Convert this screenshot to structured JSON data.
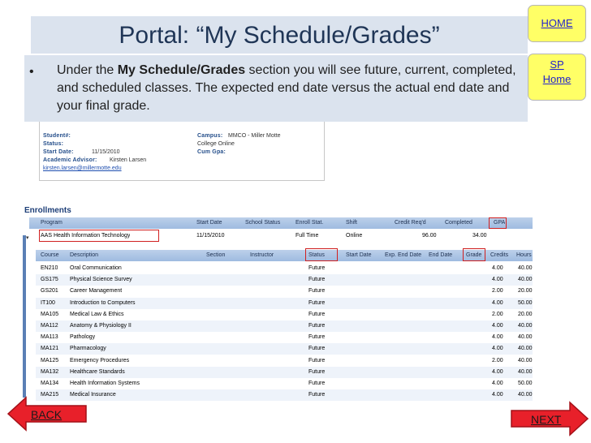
{
  "slide": {
    "title": "Portal: “My Schedule/Grades”",
    "bullet_pre": "Under the ",
    "bullet_bold": "My Schedule/Grades",
    "bullet_post": " section you will see future, current, completed, and scheduled classes. The expected end date versus the actual end date and your final grade."
  },
  "nav": {
    "home": "HOME",
    "sp_line1": "SP",
    "sp_line2": "Home",
    "back": "BACK",
    "next": "NEXT"
  },
  "student": {
    "student_label": "Student#:",
    "status_label": "Status:",
    "start_label": "Start Date:",
    "start_value": "11/15/2010",
    "advisor_label": "Academic Advisor:",
    "advisor_value": "Kirsten Larsen",
    "email": "kirsten.larsen@millermotte.edu",
    "campus_label": "Campus:",
    "campus_value": "MMCO - Miller Motte",
    "campus_status": "College Online",
    "gpa_label": "Cum Gpa:"
  },
  "enrollments": {
    "title": "Enrollments",
    "program_headers": [
      "Program",
      "Start Date",
      "School Status",
      "Enroll Stat.",
      "Shift",
      "Credit Req'd",
      "Completed",
      "GPA"
    ],
    "program_row": [
      "AAS Health Information Technology",
      "11/15/2010",
      "",
      "Full Time",
      "Online",
      "96.00",
      "34.00",
      ""
    ],
    "course_headers": [
      "Course",
      "Description",
      "Section",
      "Instructor",
      "Status",
      "Start Date",
      "Exp. End Date",
      "End Date",
      "Grade",
      "Credits",
      "Hours"
    ],
    "courses": [
      [
        "EN210",
        "Oral Communication",
        "Future",
        "4.00",
        "40.00"
      ],
      [
        "GS175",
        "Physical Science Survey",
        "Future",
        "4.00",
        "40.00"
      ],
      [
        "GS201",
        "Career Management",
        "Future",
        "2.00",
        "20.00"
      ],
      [
        "IT100",
        "Introduction to Computers",
        "Future",
        "4.00",
        "50.00"
      ],
      [
        "MA105",
        "Medical Law & Ethics",
        "Future",
        "2.00",
        "20.00"
      ],
      [
        "MA112",
        "Anatomy & Physiology II",
        "Future",
        "4.00",
        "40.00"
      ],
      [
        "MA113",
        "Pathology",
        "Future",
        "4.00",
        "40.00"
      ],
      [
        "MA121",
        "Pharmacology",
        "Future",
        "4.00",
        "40.00"
      ],
      [
        "MA125",
        "Emergency Procedures",
        "Future",
        "2.00",
        "40.00"
      ],
      [
        "MA132",
        "Healthcare Standards",
        "Future",
        "4.00",
        "40.00"
      ],
      [
        "MA134",
        "Health Information Systems",
        "Future",
        "4.00",
        "50.00"
      ],
      [
        "MA215",
        "Medical Insurance",
        "Future",
        "4.00",
        "40.00"
      ]
    ]
  }
}
